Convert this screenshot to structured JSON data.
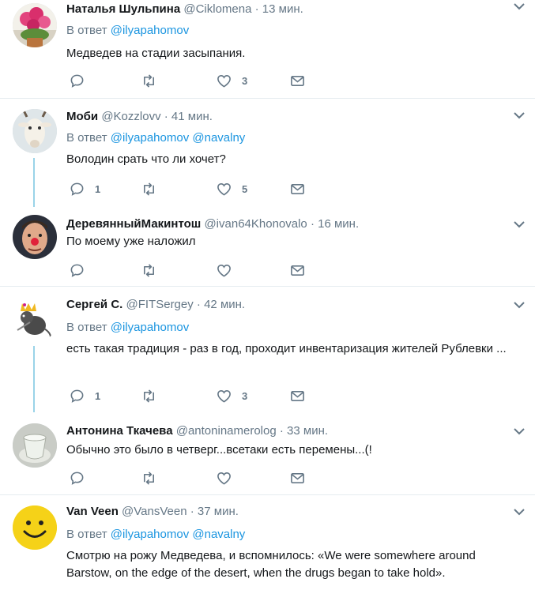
{
  "reply_prefix": "В ответ",
  "tweets": [
    {
      "name": "Наталья Шульпина",
      "handle": "@Ciklomena",
      "sep": "·",
      "time": "13 мин.",
      "reply_to": [
        "@ilyapahomov"
      ],
      "text": "Медведев на стадии засыпания.",
      "replies": "",
      "likes": "3",
      "avatar": "flower"
    },
    {
      "name": "Моби",
      "handle": "@Kozzlovv",
      "sep": "·",
      "time": "41 мин.",
      "reply_to": [
        "@ilyapahomov",
        "@navalny"
      ],
      "text": "Володин срать что ли хочет?",
      "replies": "1",
      "likes": "5",
      "avatar": "goat"
    },
    {
      "name": "ДеревянныйМакинтош",
      "handle": "@ivan64Khonovalo",
      "sep": "·",
      "time": "16 мин.",
      "reply_to": [],
      "text": "По моему уже наложил",
      "replies": "",
      "likes": "",
      "avatar": "clown"
    },
    {
      "name": "Сергей С.",
      "handle": "@FITSergey",
      "sep": "·",
      "time": "42 мин.",
      "reply_to": [
        "@ilyapahomov"
      ],
      "text": "есть такая традиция - раз в год, проходит инвентаризация жителей Рублевки ...",
      "replies": "1",
      "likes": "3",
      "avatar": "rat"
    },
    {
      "name": "Антонина Ткачева",
      "handle": "@antoninamerolog",
      "sep": "·",
      "time": "33 мин.",
      "reply_to": [],
      "text": "Обычно это было в четверг...всетаки есть перемены...(!",
      "replies": "",
      "likes": "",
      "avatar": "glass"
    },
    {
      "name": "Van Veen",
      "handle": "@VansVeen",
      "sep": "·",
      "time": "37 мин.",
      "reply_to": [
        "@ilyapahomov",
        "@navalny"
      ],
      "text": "Смотрю на рожу Медведева, и вспомнилось: «We were somewhere around Barstow, on the edge of the desert, when the drugs began to take hold».",
      "replies": "",
      "likes": "",
      "avatar": "smiley"
    }
  ]
}
